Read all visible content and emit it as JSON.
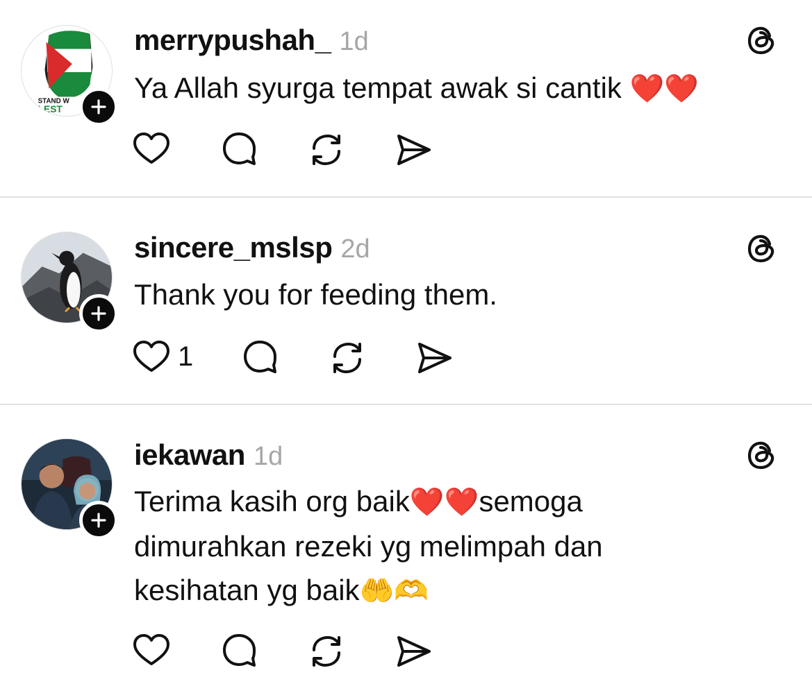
{
  "posts": [
    {
      "username": "merrypushah_",
      "time": "1d",
      "lines": [
        "Ya Allah syurga tempat awak si cantik"
      ],
      "emoji": "❤️❤️",
      "avatar_text": "STAND W… LEST…",
      "like_count": ""
    },
    {
      "username": "sincere_mslsp",
      "time": "2d",
      "lines": [
        "Thank you for feeding them."
      ],
      "like_count": "1"
    },
    {
      "username": "iekawan",
      "time": "1d",
      "line1_before": "Terima kasih org baik",
      "line1_emoji": "❤️❤️",
      "line1_after": "semoga",
      "line2": "dimurahkan rezeki yg melimpah dan",
      "line3_before": "kesihatan yg baik",
      "line3_emoji": "🤲🫶",
      "like_count": ""
    }
  ],
  "icons": {
    "like": "heart-outline-icon",
    "reply": "speech-bubble-icon",
    "repost": "repost-arrows-icon",
    "share": "paper-plane-icon",
    "app": "threads-logo-icon",
    "follow": "plus-icon"
  },
  "colors": {
    "timestamp": "#a6a6a6",
    "badge": "#0b0b0b",
    "divider": "#e2e2e2"
  }
}
